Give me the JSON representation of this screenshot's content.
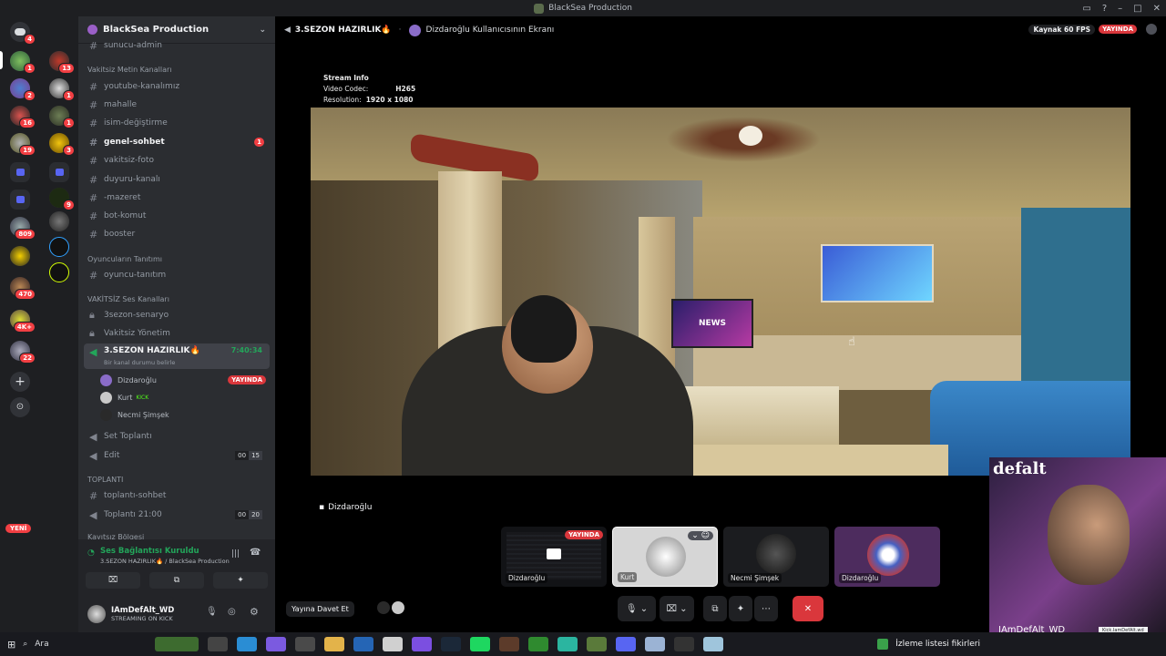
{
  "window": {
    "title": "BlackSea Production"
  },
  "server_rail": {
    "badges": [
      "4",
      "1",
      "2",
      "16",
      "19",
      "13",
      "1",
      "1",
      "3",
      "9",
      "809",
      "470",
      "4K+",
      "22"
    ],
    "new_label": "YENİ"
  },
  "sidebar": {
    "server_name": "BlackSea Production",
    "top_channel": "sunucu-admin",
    "cat_text": "Vakitsiz Metin Kanalları",
    "text_channels": [
      "youtube-kanalımız",
      "mahalle",
      "isim-değiştirme",
      "genel-sohbet",
      "vakitsiz-foto",
      "duyuru-kanalı",
      "-mazeret",
      "bot-komut",
      "booster"
    ],
    "genel_badge": "1",
    "cat_players": "Oyuncuların Tanıtımı",
    "player_channel": "oyuncu-tanıtım",
    "cat_voice": "VAKİTSİZ Ses Kanalları",
    "voice_channels": [
      "3sezon-senaryo",
      "Vakitsiz Yönetim"
    ],
    "active_voice": "3.SEZON HAZIRLIK🔥",
    "active_time": "7:40:34",
    "active_status": "Bir kanal durumu belirle",
    "voice_users": [
      {
        "name": "Dizdaroğlu",
        "tag": "YAYINDA"
      },
      {
        "name": "Kurt",
        "tag": "KICK"
      },
      {
        "name": "Necmi Şimşek",
        "tag": ""
      }
    ],
    "set_channel": "Set Toplantı",
    "edit_channel": "Edit",
    "edit_counts": [
      "00",
      "15"
    ],
    "cat_meeting": "TOPLANTI",
    "meeting_text": "toplantı-sohbet",
    "meeting_voice": "Toplantı 21:00",
    "meeting_counts": [
      "00",
      "20"
    ],
    "cat_hidden": "Kayıtsız Bölgesi"
  },
  "voice_status": {
    "title": "Ses Bağlantısı Kuruldu",
    "sub": "3.SEZON HAZIRLIK🔥 / BlackSea Production"
  },
  "user_panel": {
    "name": "IAmDefAlt_WD",
    "status": "STREAMING ON KICK"
  },
  "main": {
    "channel": "3.SEZON HAZIRLIK🔥",
    "screen": "Dizdaroğlu Kullanıcısının Ekranı",
    "source": "Kaynak 60 FPS",
    "live": "YAYINDA",
    "stream_info": {
      "title": "Stream Info",
      "codec_label": "Video Codec:",
      "codec": "H265",
      "res_label": "Resolution:",
      "res": "1920 x 1080"
    },
    "tv_text": "NEWS",
    "streamer_label": "Dizdaroğlu",
    "tiles": [
      {
        "name": "Dizdaroğlu",
        "tag": "YAYINDA"
      },
      {
        "name": "Kurt",
        "tag": ""
      },
      {
        "name": "Necmi Şimşek",
        "tag": ""
      },
      {
        "name": "Dizdaroğlu",
        "tag": ""
      }
    ],
    "invite": "Yayına Davet Et"
  },
  "webcam": {
    "name": "IAmDefAlt_WD",
    "logo": "defalt",
    "chip": "Kick.IamDefAlt.wd"
  },
  "taskbar": {
    "search": "Ara",
    "widget": "İzleme listesi fikirleri"
  },
  "colors": {
    "accent": "#5865f2",
    "live": "#da373c",
    "connected": "#23a55a"
  }
}
